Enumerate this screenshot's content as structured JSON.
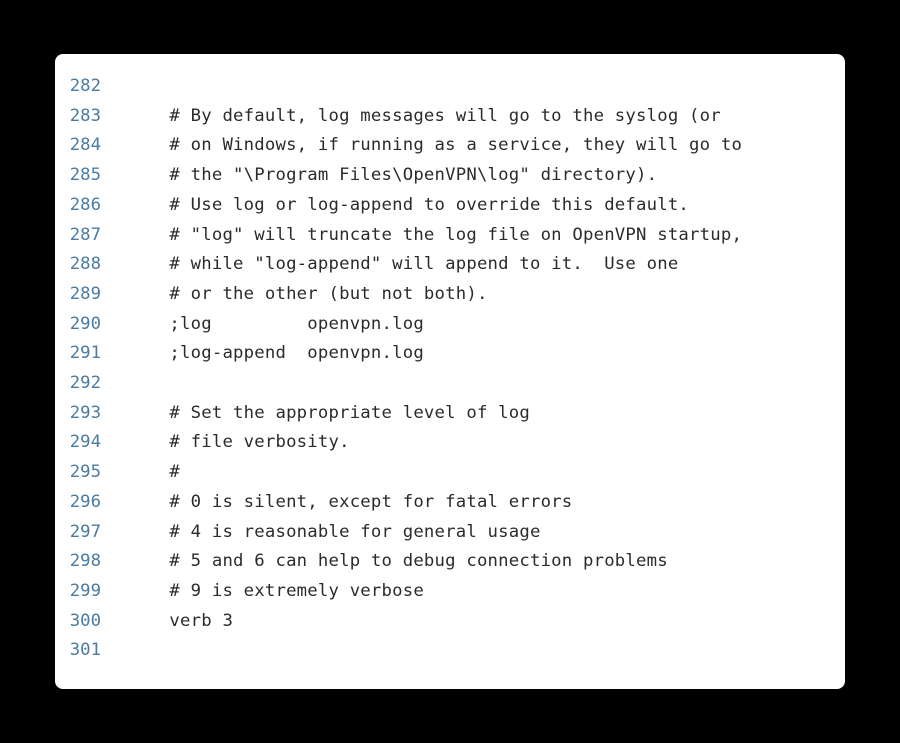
{
  "lines": [
    {
      "num": "282",
      "text": ""
    },
    {
      "num": "283",
      "text": "    # By default, log messages will go to the syslog (or"
    },
    {
      "num": "284",
      "text": "    # on Windows, if running as a service, they will go to"
    },
    {
      "num": "285",
      "text": "    # the \"\\Program Files\\OpenVPN\\log\" directory)."
    },
    {
      "num": "286",
      "text": "    # Use log or log-append to override this default."
    },
    {
      "num": "287",
      "text": "    # \"log\" will truncate the log file on OpenVPN startup,"
    },
    {
      "num": "288",
      "text": "    # while \"log-append\" will append to it.  Use one"
    },
    {
      "num": "289",
      "text": "    # or the other (but not both)."
    },
    {
      "num": "290",
      "text": "    ;log         openvpn.log"
    },
    {
      "num": "291",
      "text": "    ;log-append  openvpn.log"
    },
    {
      "num": "292",
      "text": ""
    },
    {
      "num": "293",
      "text": "    # Set the appropriate level of log"
    },
    {
      "num": "294",
      "text": "    # file verbosity."
    },
    {
      "num": "295",
      "text": "    #"
    },
    {
      "num": "296",
      "text": "    # 0 is silent, except for fatal errors"
    },
    {
      "num": "297",
      "text": "    # 4 is reasonable for general usage"
    },
    {
      "num": "298",
      "text": "    # 5 and 6 can help to debug connection problems"
    },
    {
      "num": "299",
      "text": "    # 9 is extremely verbose"
    },
    {
      "num": "300",
      "text": "    verb 3"
    },
    {
      "num": "301",
      "text": ""
    }
  ]
}
